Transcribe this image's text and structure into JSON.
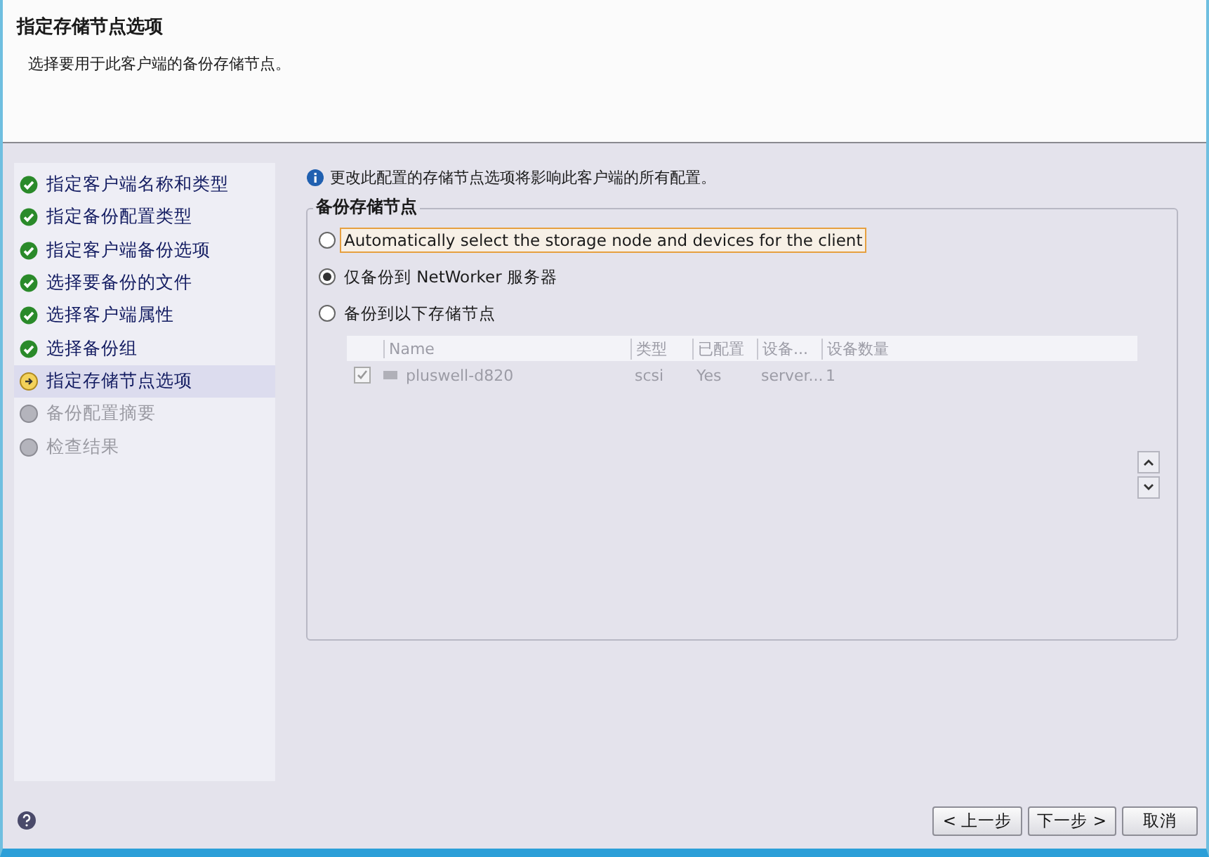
{
  "header": {
    "title": "指定存储节点选项",
    "subtitle": "选择要用于此客户端的备份存储节点。"
  },
  "steps": [
    {
      "label": "指定客户端名称和类型",
      "kind": "done",
      "selected": false
    },
    {
      "label": "指定备份配置类型",
      "kind": "done",
      "selected": false
    },
    {
      "label": "指定客户端备份选项",
      "kind": "done",
      "selected": false
    },
    {
      "label": "选择要备份的文件",
      "kind": "done",
      "selected": false
    },
    {
      "label": "选择客户端属性",
      "kind": "done",
      "selected": false
    },
    {
      "label": "选择备份组",
      "kind": "done",
      "selected": false
    },
    {
      "label": "指定存储节点选项",
      "kind": "current",
      "selected": true
    },
    {
      "label": "备份配置摘要",
      "kind": "pending",
      "selected": false
    },
    {
      "label": "检查结果",
      "kind": "pending",
      "selected": false
    }
  ],
  "info": "更改此配置的存储节点选项将影响此客户端的所有配置。",
  "group": {
    "title": "备份存储节点",
    "options": [
      {
        "label": "Automatically select the storage node and devices for the client",
        "selected": false,
        "focused": true
      },
      {
        "label": "仅备份到 NetWorker 服务器",
        "selected": true,
        "focused": false
      },
      {
        "label": "备份到以下存储节点",
        "selected": false,
        "focused": false
      }
    ],
    "table": {
      "disabled": true,
      "columns": [
        "Name",
        "类型",
        "已配置",
        "设备...",
        "设备数量"
      ],
      "rows": [
        {
          "checked": true,
          "cells": [
            "pluswell-d820",
            "scsi",
            "Yes",
            "server...",
            "1"
          ]
        }
      ]
    }
  },
  "buttons": [
    {
      "label": "< 上一步"
    },
    {
      "label": "下一步 >"
    },
    {
      "label": "取消"
    }
  ]
}
